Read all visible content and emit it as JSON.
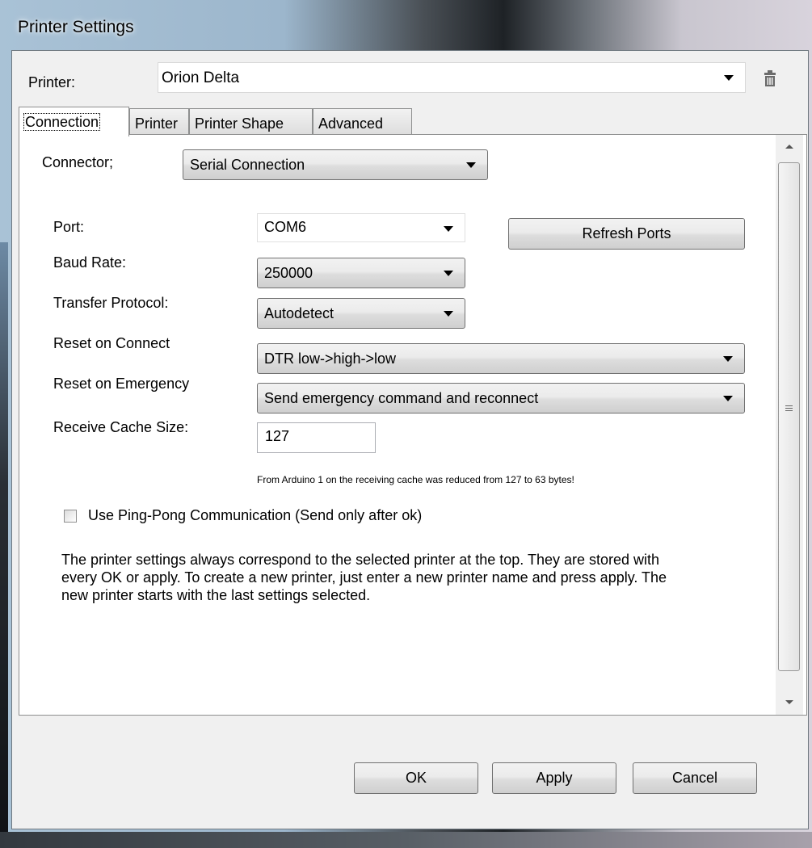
{
  "window": {
    "title": "Printer Settings"
  },
  "printer": {
    "label": "Printer:",
    "selected": "Orion Delta"
  },
  "tabs": [
    {
      "label": "Connection",
      "active": true
    },
    {
      "label": "Printer",
      "active": false
    },
    {
      "label": "Printer Shape",
      "active": false
    },
    {
      "label": "Advanced",
      "active": false
    }
  ],
  "connection": {
    "connector_label": "Connector;",
    "connector_value": "Serial Connection",
    "port_label": "Port:",
    "port_value": "COM6",
    "refresh_label": "Refresh Ports",
    "baud_label": "Baud Rate:",
    "baud_value": "250000",
    "protocol_label": "Transfer Protocol:",
    "protocol_value": "Autodetect",
    "reset_connect_label": "Reset on Connect",
    "reset_connect_value": "DTR low->high->low",
    "reset_emergency_label": "Reset on Emergency",
    "reset_emergency_value": "Send emergency command and reconnect",
    "cache_label": "Receive Cache Size:",
    "cache_value": "127",
    "cache_hint": "From Arduino 1 on the receiving cache was reduced from 127 to 63 bytes!",
    "pingpong_label": "Use Ping-Pong Communication (Send only after ok)",
    "pingpong_checked": false,
    "info_text": "The printer settings always correspond to the selected printer at the top. They are stored with every OK or apply. To create a new printer, just enter a new printer name and press apply. The new printer starts with the last settings selected."
  },
  "buttons": {
    "ok": "OK",
    "apply": "Apply",
    "cancel": "Cancel"
  },
  "icons": {
    "delete": "trash-icon",
    "dropdown": "chevron-down-icon"
  }
}
